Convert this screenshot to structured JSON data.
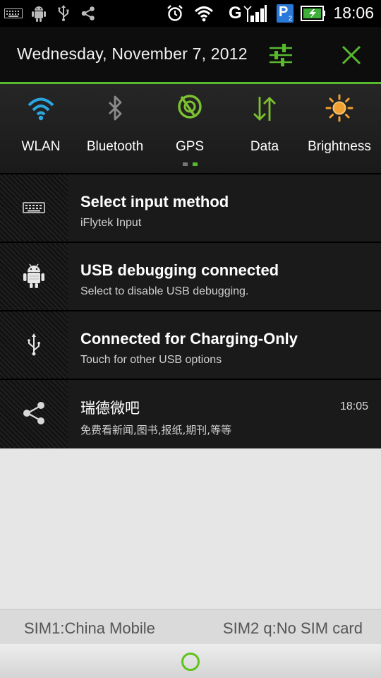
{
  "status_bar": {
    "time": "18:06",
    "left_icons": [
      "keyboard-icon",
      "android-icon",
      "usb-icon",
      "share-icon"
    ],
    "right_icons": [
      "alarm-icon",
      "wifi-icon",
      "signal-icon",
      "sim2-icon",
      "battery-charging-icon"
    ],
    "network_letter": "G",
    "sim_letter": "P"
  },
  "header": {
    "date": "Wednesday, November 7, 2012",
    "accent_color": "#58b82e"
  },
  "quick_settings": [
    {
      "label": "WLAN",
      "icon": "wifi-icon",
      "color": "#2aa7e0"
    },
    {
      "label": "Bluetooth",
      "icon": "bluetooth-icon",
      "color": "#8a8a8a"
    },
    {
      "label": "GPS",
      "icon": "gps-icon",
      "color": "#7cc22f"
    },
    {
      "label": "Data",
      "icon": "data-arrows-icon",
      "color": "#7cc22f"
    },
    {
      "label": "Brightness",
      "icon": "brightness-icon",
      "color": "#f0a030"
    }
  ],
  "notifications": [
    {
      "title": "Select input method",
      "subtitle": "iFlytek Input",
      "icon": "keyboard-icon",
      "time": ""
    },
    {
      "title": "USB debugging connected",
      "subtitle": "Select to disable USB debugging.",
      "icon": "android-icon",
      "time": ""
    },
    {
      "title": "Connected for Charging-Only",
      "subtitle": "Touch for other USB options",
      "icon": "usb-icon",
      "time": ""
    },
    {
      "title": "瑞德微吧",
      "subtitle": "免费看新闻,图书,报纸,期刊,等等",
      "icon": "share-icon",
      "time": "18:05"
    }
  ],
  "carriers": {
    "sim1": "SIM1:China Mobile",
    "sim2": "SIM2 q:No SIM card"
  }
}
